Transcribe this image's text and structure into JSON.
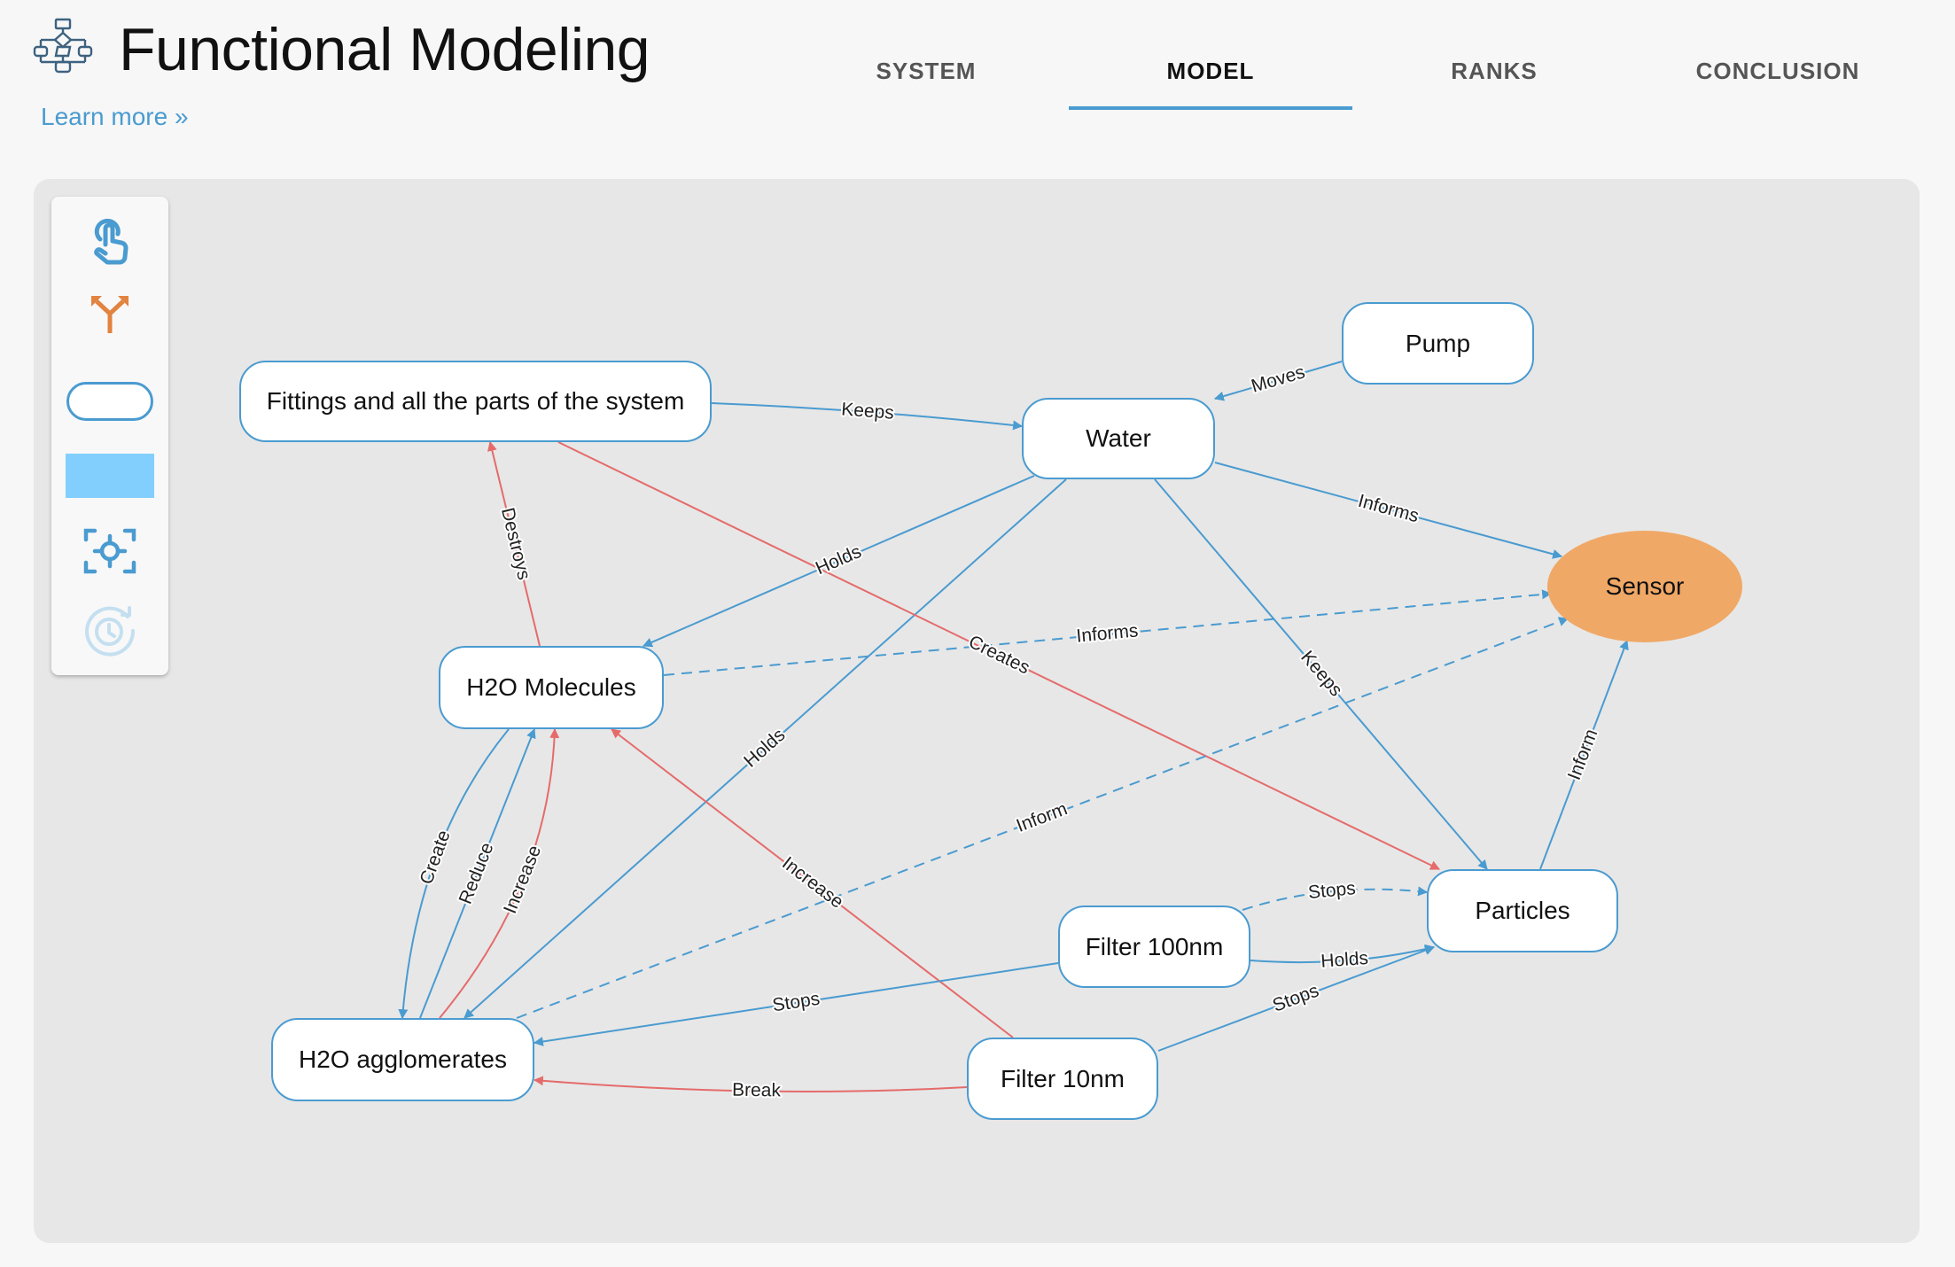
{
  "header": {
    "title": "Functional Modeling",
    "learn_more": "Learn more »",
    "logo_icon": "flowchart-icon"
  },
  "tabs": [
    {
      "label": "SYSTEM",
      "active": false
    },
    {
      "label": "MODEL",
      "active": true
    },
    {
      "label": "RANKS",
      "active": false
    },
    {
      "label": "CONCLUSION",
      "active": false
    }
  ],
  "toolbar": {
    "tools": [
      {
        "name": "select-tool",
        "icon": "pointer-hand-icon"
      },
      {
        "name": "connect-tool",
        "icon": "split-arrow-icon"
      },
      {
        "name": "add-node-tool",
        "icon": "rounded-node-icon"
      },
      {
        "name": "add-area-tool",
        "icon": "area-rectangle-icon"
      },
      {
        "name": "center-view-tool",
        "icon": "focus-target-icon"
      },
      {
        "name": "history-tool",
        "icon": "history-clock-icon",
        "disabled": true
      }
    ]
  },
  "colors": {
    "accent": "#4a9bd0",
    "negative_edge": "#e56b6b",
    "sensor_fill": "#f0a866",
    "canvas_bg": "#e7e7e7"
  },
  "diagram": {
    "nodes": [
      {
        "id": "fittings",
        "label": "Fittings and all the parts of the system",
        "shape": "rounded"
      },
      {
        "id": "water",
        "label": "Water",
        "shape": "rounded"
      },
      {
        "id": "pump",
        "label": "Pump",
        "shape": "rounded"
      },
      {
        "id": "sensor",
        "label": "Sensor",
        "shape": "ellipse"
      },
      {
        "id": "h2o_molecules",
        "label": "H2O Molecules",
        "shape": "rounded"
      },
      {
        "id": "h2o_agglomerates",
        "label": "H2O agglomerates",
        "shape": "rounded"
      },
      {
        "id": "filter_100nm",
        "label": "Filter 100nm",
        "shape": "rounded"
      },
      {
        "id": "particles",
        "label": "Particles",
        "shape": "rounded"
      },
      {
        "id": "filter_10nm",
        "label": "Filter 10nm",
        "shape": "rounded"
      }
    ],
    "edges": [
      {
        "from": "fittings",
        "to": "water",
        "label": "Keeps",
        "kind": "useful",
        "style": "solid"
      },
      {
        "from": "pump",
        "to": "water",
        "label": "Moves",
        "kind": "useful",
        "style": "solid"
      },
      {
        "from": "water",
        "to": "sensor",
        "label": "Informs",
        "kind": "useful",
        "style": "solid"
      },
      {
        "from": "water",
        "to": "h2o_molecules",
        "label": "Holds",
        "kind": "useful",
        "style": "solid"
      },
      {
        "from": "water",
        "to": "h2o_agglomerates",
        "label": "Holds",
        "kind": "useful",
        "style": "solid"
      },
      {
        "from": "water",
        "to": "particles",
        "label": "Keeps",
        "kind": "useful",
        "style": "solid"
      },
      {
        "from": "fittings",
        "to": "particles",
        "label": "Creates",
        "kind": "harmful",
        "style": "solid"
      },
      {
        "from": "h2o_molecules",
        "to": "fittings",
        "label": "Destroys",
        "kind": "harmful",
        "style": "solid"
      },
      {
        "from": "h2o_molecules",
        "to": "sensor",
        "label": "Informs",
        "kind": "useful",
        "style": "dashed"
      },
      {
        "from": "h2o_agglomerates",
        "to": "sensor",
        "label": "Inform",
        "kind": "useful",
        "style": "dashed"
      },
      {
        "from": "particles",
        "to": "sensor",
        "label": "Inform",
        "kind": "useful",
        "style": "solid"
      },
      {
        "from": "h2o_molecules",
        "to": "h2o_agglomerates",
        "label": "Create",
        "kind": "useful",
        "style": "solid"
      },
      {
        "from": "h2o_agglomerates",
        "to": "h2o_molecules",
        "label": "Reduce",
        "kind": "useful",
        "style": "solid"
      },
      {
        "from": "h2o_agglomerates",
        "to": "h2o_molecules",
        "label": "Increase",
        "kind": "harmful",
        "style": "solid"
      },
      {
        "from": "filter_10nm",
        "to": "h2o_molecules",
        "label": "Increase",
        "kind": "harmful",
        "style": "solid"
      },
      {
        "from": "filter_100nm",
        "to": "h2o_agglomerates",
        "label": "Stops",
        "kind": "useful",
        "style": "solid"
      },
      {
        "from": "filter_10nm",
        "to": "h2o_agglomerates",
        "label": "Break",
        "kind": "harmful",
        "style": "solid"
      },
      {
        "from": "filter_100nm",
        "to": "particles",
        "label": "Stops",
        "kind": "useful",
        "style": "dashed"
      },
      {
        "from": "filter_100nm",
        "to": "particles",
        "label": "Holds",
        "kind": "useful",
        "style": "solid"
      },
      {
        "from": "filter_10nm",
        "to": "particles",
        "label": "Stops",
        "kind": "useful",
        "style": "solid"
      }
    ]
  }
}
